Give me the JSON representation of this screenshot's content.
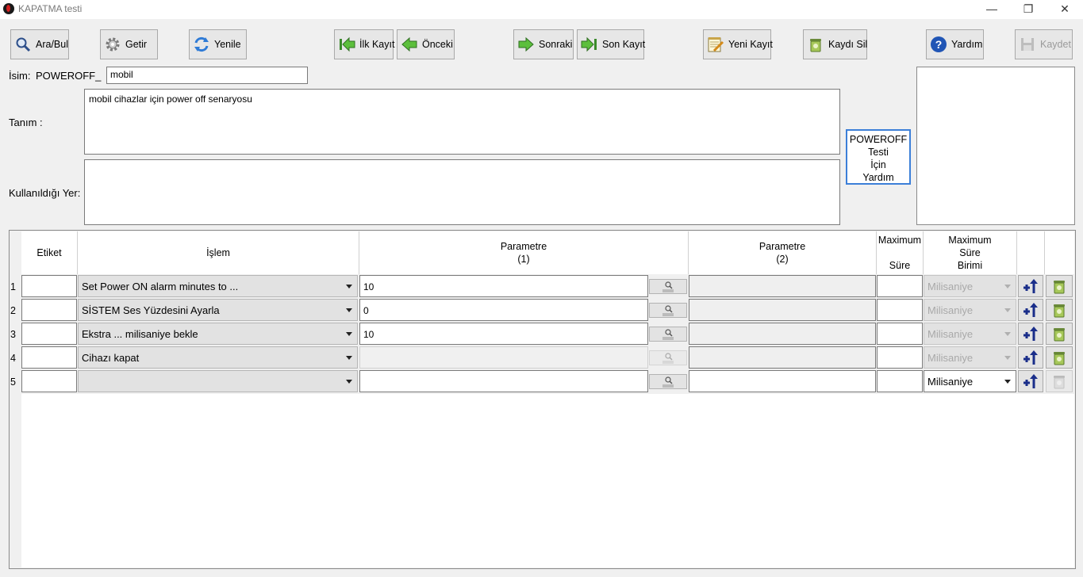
{
  "window": {
    "title": "KAPATMA testi",
    "minimize": "—",
    "maximize": "❐",
    "close": "✕"
  },
  "toolbar": {
    "search": "Ara/Bul",
    "fetch": "Getir",
    "refresh": "Yenile",
    "first": "İlk Kayıt",
    "previous": "Önceki",
    "next": "Sonraki",
    "last": "Son Kayıt",
    "new": "Yeni Kayıt",
    "delete": "Kaydı Sil",
    "help": "Yardım",
    "save": "Kaydet"
  },
  "form": {
    "name_label": "İsim:",
    "name_prefix": "POWEROFF_",
    "name_value": "mobil",
    "description_label": "Tanım :",
    "description_value": "mobil cihazlar için power off senaryosu",
    "used_in_label": "Kullanıldığı Yer:",
    "used_in_value": "",
    "help_lines": [
      "POWEROFF",
      "Testi",
      "İçin",
      "Yardım"
    ]
  },
  "grid": {
    "headers": {
      "etiket": "Etiket",
      "islem": "İşlem",
      "param1_line1": "Parametre",
      "param1_line2": "(1)",
      "param2_line1": "Parametre",
      "param2_line2": "(2)",
      "max_sure_line1": "Maximum",
      "max_sure_line2": "Süre",
      "birim_line1": "Maximum",
      "birim_line2": "Süre",
      "birim_line3": "Birimi"
    },
    "rows": [
      {
        "num": "1",
        "etiket": "",
        "islem": "Set Power ON alarm minutes to ...",
        "param1": "10",
        "param2": "",
        "sure": "",
        "birim": "Milisaniye"
      },
      {
        "num": "2",
        "etiket": "",
        "islem": "SİSTEM Ses Yüzdesini Ayarla",
        "param1": "0",
        "param2": "",
        "sure": "",
        "birim": "Milisaniye"
      },
      {
        "num": "3",
        "etiket": "",
        "islem": "Ekstra ... milisaniye bekle",
        "param1": "10",
        "param2": "",
        "sure": "",
        "birim": "Milisaniye"
      },
      {
        "num": "4",
        "etiket": "",
        "islem": "Cihazı kapat",
        "param1": "",
        "param2": "",
        "sure": "",
        "birim": "Milisaniye"
      },
      {
        "num": "5",
        "etiket": "",
        "islem": "",
        "param1": "",
        "param2": "",
        "sure": "",
        "birim": "Milisaniye"
      }
    ]
  }
}
